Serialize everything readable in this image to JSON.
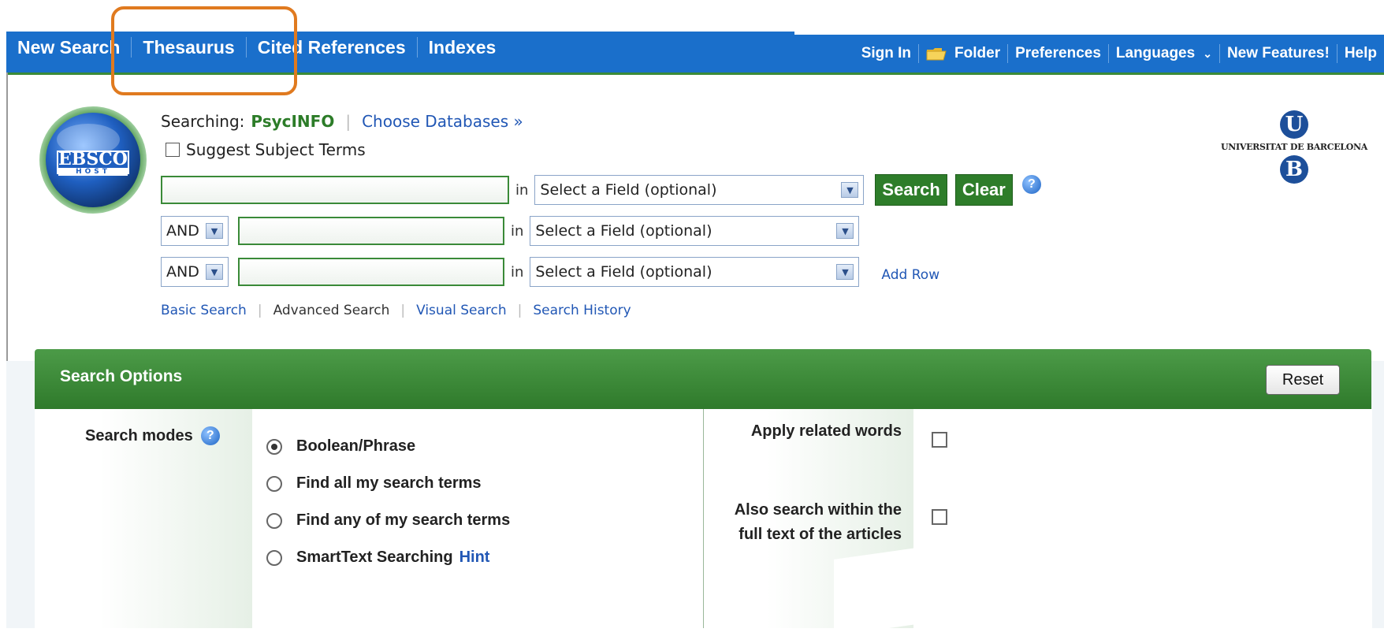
{
  "nav_left": {
    "items": [
      "New Search",
      "Thesaurus",
      "Cited References",
      "Indexes"
    ]
  },
  "nav_right": {
    "items": [
      "Sign In",
      "Folder",
      "Preferences",
      "Languages",
      "New Features!",
      "Help"
    ]
  },
  "logos": {
    "ebsco_text": "EBSCO",
    "ebsco_sub": "HOST",
    "ub_top": "U",
    "ub_text": "UNIVERSITAT DE BARCELONA",
    "ub_bottom": "B"
  },
  "search": {
    "searching_label": "Searching:",
    "database": "PsycINFO",
    "choose_db": "Choose Databases »",
    "suggest_terms": "Suggest Subject Terms",
    "in_label": "in",
    "field_placeholder": "Select a Field (optional)",
    "bool_op": "AND",
    "search_button": "Search",
    "clear_button": "Clear",
    "add_row": "Add Row",
    "rows": [
      {
        "value": ""
      },
      {
        "value": ""
      },
      {
        "value": ""
      }
    ]
  },
  "search_links": {
    "basic": "Basic Search",
    "advanced": "Advanced Search",
    "visual": "Visual Search",
    "history": "Search History"
  },
  "options": {
    "title": "Search Options",
    "reset": "Reset",
    "modes_label": "Search modes",
    "modes": [
      {
        "label": "Boolean/Phrase",
        "selected": true
      },
      {
        "label": "Find all my search terms",
        "selected": false
      },
      {
        "label": "Find any of my search terms",
        "selected": false
      },
      {
        "label": "SmartText Searching",
        "selected": false
      }
    ],
    "hint": "Hint",
    "related_words": "Apply related words",
    "full_text_line1": "Also search within the",
    "full_text_line2": "full text of the articles"
  },
  "colors": {
    "nav_blue": "#1a6fcb",
    "accent_green": "#2e7d2a",
    "highlight_orange": "#e07a1f",
    "link_blue": "#2157b5"
  }
}
